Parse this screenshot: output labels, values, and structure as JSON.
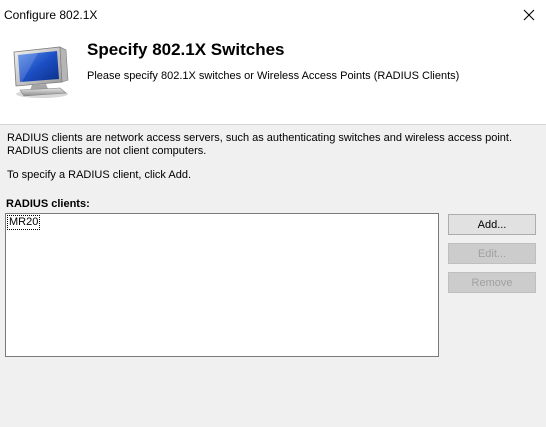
{
  "window": {
    "title": "Configure 802.1X"
  },
  "header": {
    "title": "Specify 802.1X Switches",
    "subtitle": "Please specify 802.1X switches or Wireless Access Points (RADIUS Clients)",
    "icon": "computer-monitor-icon"
  },
  "body": {
    "description_line1": "RADIUS clients are network access servers, such as authenticating switches and wireless access point.",
    "description_line2": "RADIUS clients are not client computers.",
    "instruction": "To specify a RADIUS client, click Add.",
    "list_label": "RADIUS clients:",
    "clients": [
      "MR20"
    ]
  },
  "buttons": {
    "add": "Add...",
    "edit": "Edit...",
    "remove": "Remove"
  },
  "colors": {
    "dialog_bg": "#f0f0f0",
    "header_bg": "#ffffff",
    "disabled_text": "#a0a0a0"
  }
}
